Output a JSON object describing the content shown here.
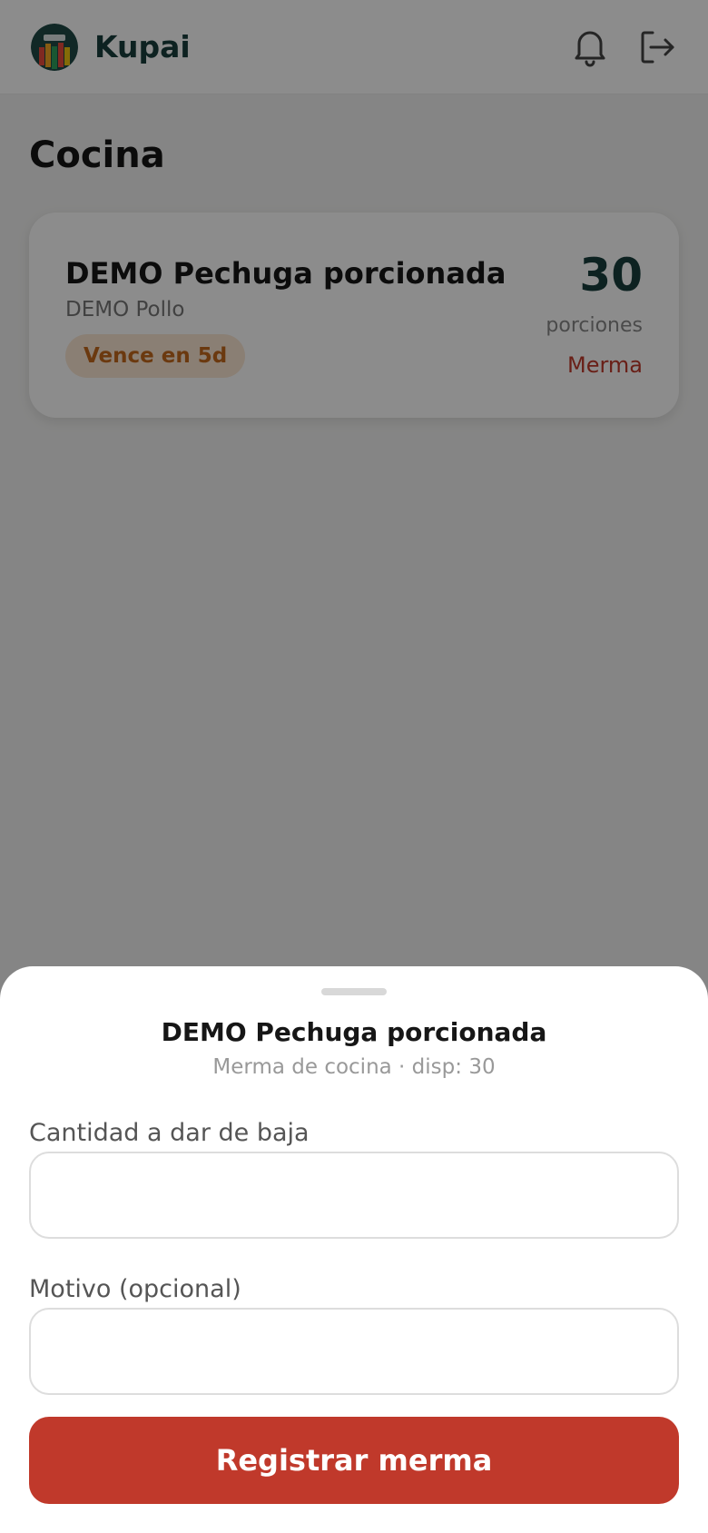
{
  "header": {
    "brand": "Kupai",
    "logo_icon": "kupai-logo",
    "notifications_icon": "bell-icon",
    "logout_icon": "logout-icon"
  },
  "page": {
    "title": "Cocina"
  },
  "item_card": {
    "name": "DEMO Pechuga porcionada",
    "subtitle": "DEMO Pollo",
    "badge": "Vence en 5d",
    "quantity": "30",
    "unit": "porciones",
    "action": "Merma"
  },
  "sheet": {
    "title": "DEMO Pechuga porcionada",
    "subtitle": "Merma de cocina · disp: 30",
    "quantity_label": "Cantidad a dar de baja",
    "quantity_value": "",
    "reason_label": "Motivo (opcional)",
    "reason_value": "",
    "submit_label": "Registrar merma"
  },
  "colors": {
    "brand_dark": "#183f3c",
    "danger": "#c0392b",
    "badge_bg": "#fbe7d4",
    "badge_text": "#c4681d"
  }
}
